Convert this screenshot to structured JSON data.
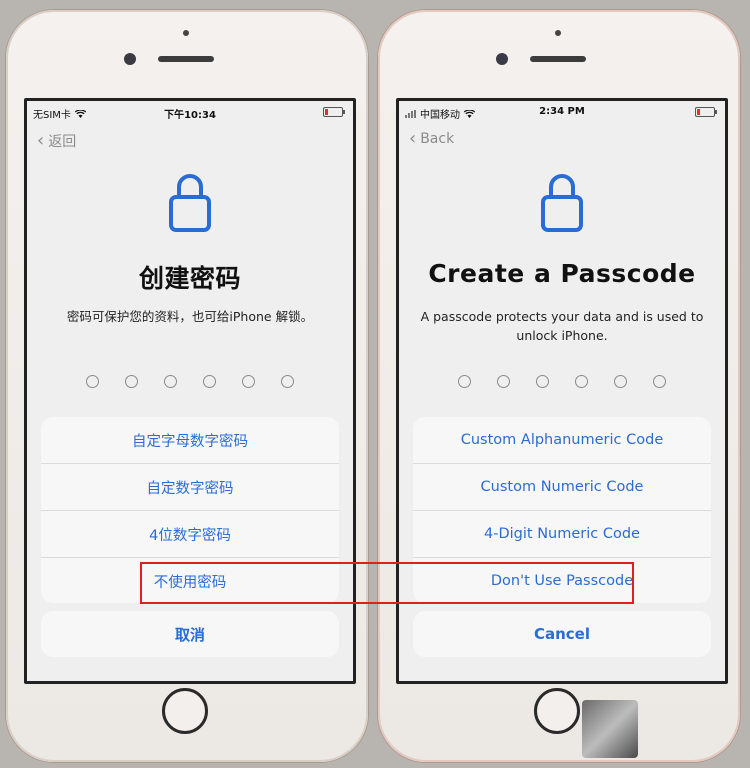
{
  "left_phone": {
    "status": {
      "carrier": "无SIM卡",
      "time": "下午10:34"
    },
    "back_label": "返回",
    "title": "创建密码",
    "description": "密码可保护您的资料，也可给iPhone 解锁。",
    "options": [
      "自定字母数字密码",
      "自定数字密码",
      "4位数字密码",
      "不使用密码"
    ],
    "cancel_label": "取消"
  },
  "right_phone": {
    "status": {
      "carrier": "中国移动",
      "time": "2:34 PM"
    },
    "back_label": "Back",
    "title": "Create a Passcode",
    "description": "A passcode protects your data and is used to unlock iPhone.",
    "options": [
      "Custom Alphanumeric Code",
      "Custom Numeric Code",
      "4-Digit Numeric Code",
      "Don't Use Passcode"
    ],
    "cancel_label": "Cancel"
  },
  "passcode_dot_count": 6,
  "icons": [
    "lock-icon",
    "chevron-left-icon",
    "wifi-icon",
    "signal-icon",
    "battery-icon"
  ],
  "colors": {
    "accent": "#2b6cd4",
    "highlight": "#e02020"
  }
}
